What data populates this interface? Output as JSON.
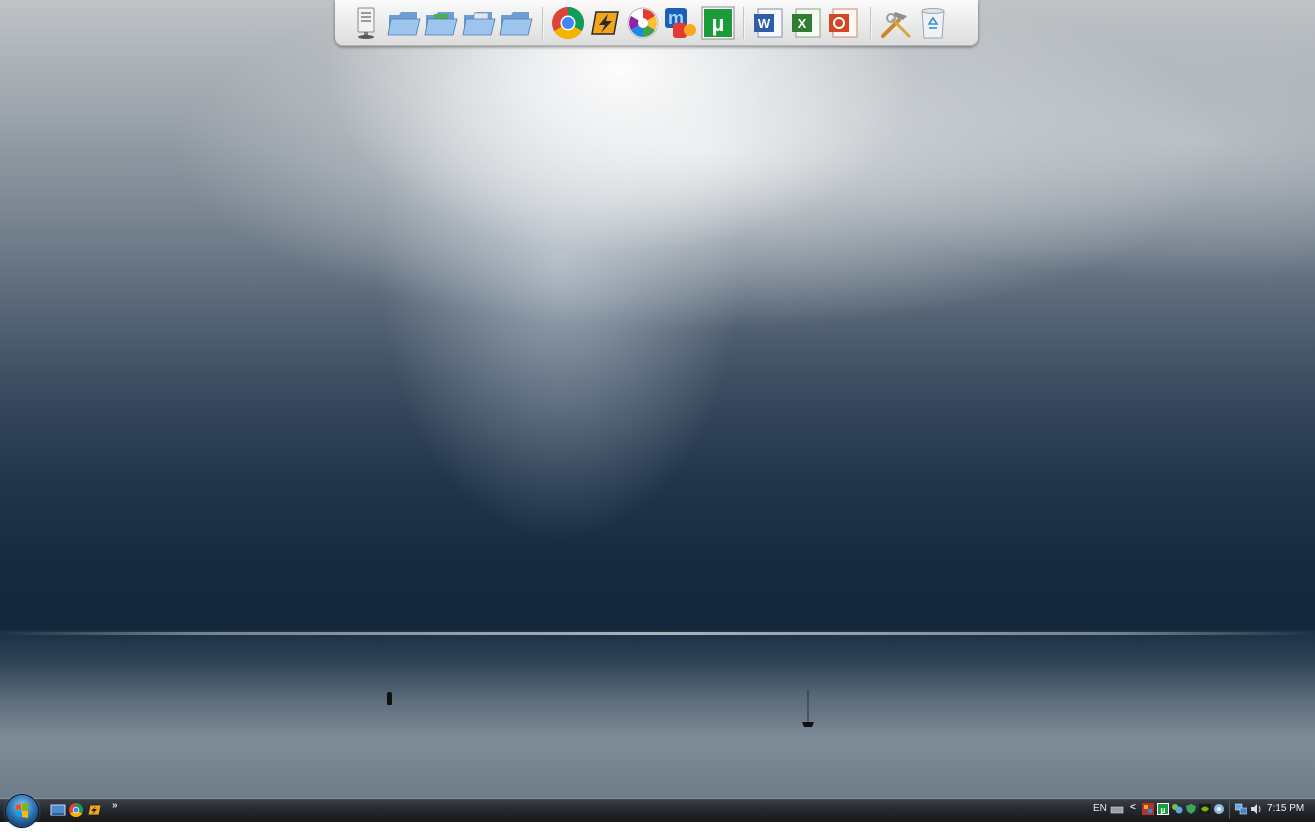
{
  "dock": {
    "items": [
      {
        "name": "computer-icon",
        "label": "Computer"
      },
      {
        "name": "folder-icon-1",
        "label": "Folder"
      },
      {
        "name": "folder-icon-2",
        "label": "Folder"
      },
      {
        "name": "folder-icon-3",
        "label": "Folder"
      },
      {
        "name": "folder-icon-4",
        "label": "Folder"
      },
      {
        "name": "chrome-icon",
        "label": "Google Chrome"
      },
      {
        "name": "winamp-icon",
        "label": "Winamp"
      },
      {
        "name": "picasa-icon",
        "label": "Picasa"
      },
      {
        "name": "messenger-icon",
        "label": "Messenger"
      },
      {
        "name": "utorrent-icon",
        "label": "uTorrent"
      },
      {
        "name": "word-icon",
        "label": "Word"
      },
      {
        "name": "excel-icon",
        "label": "Excel"
      },
      {
        "name": "powerpoint-icon",
        "label": "PowerPoint"
      },
      {
        "name": "tools-icon",
        "label": "Tools"
      },
      {
        "name": "recycle-bin-icon",
        "label": "Recycle Bin"
      }
    ]
  },
  "taskbar": {
    "quick_launch": [
      "show-desktop-icon",
      "chrome-icon",
      "winamp-icon"
    ],
    "chevron": "»",
    "language": "EN",
    "tray_arrow": "<",
    "clock": "7:15 PM"
  },
  "colors": {
    "accent": "#2f78b7",
    "taskbar": "#25282d"
  }
}
